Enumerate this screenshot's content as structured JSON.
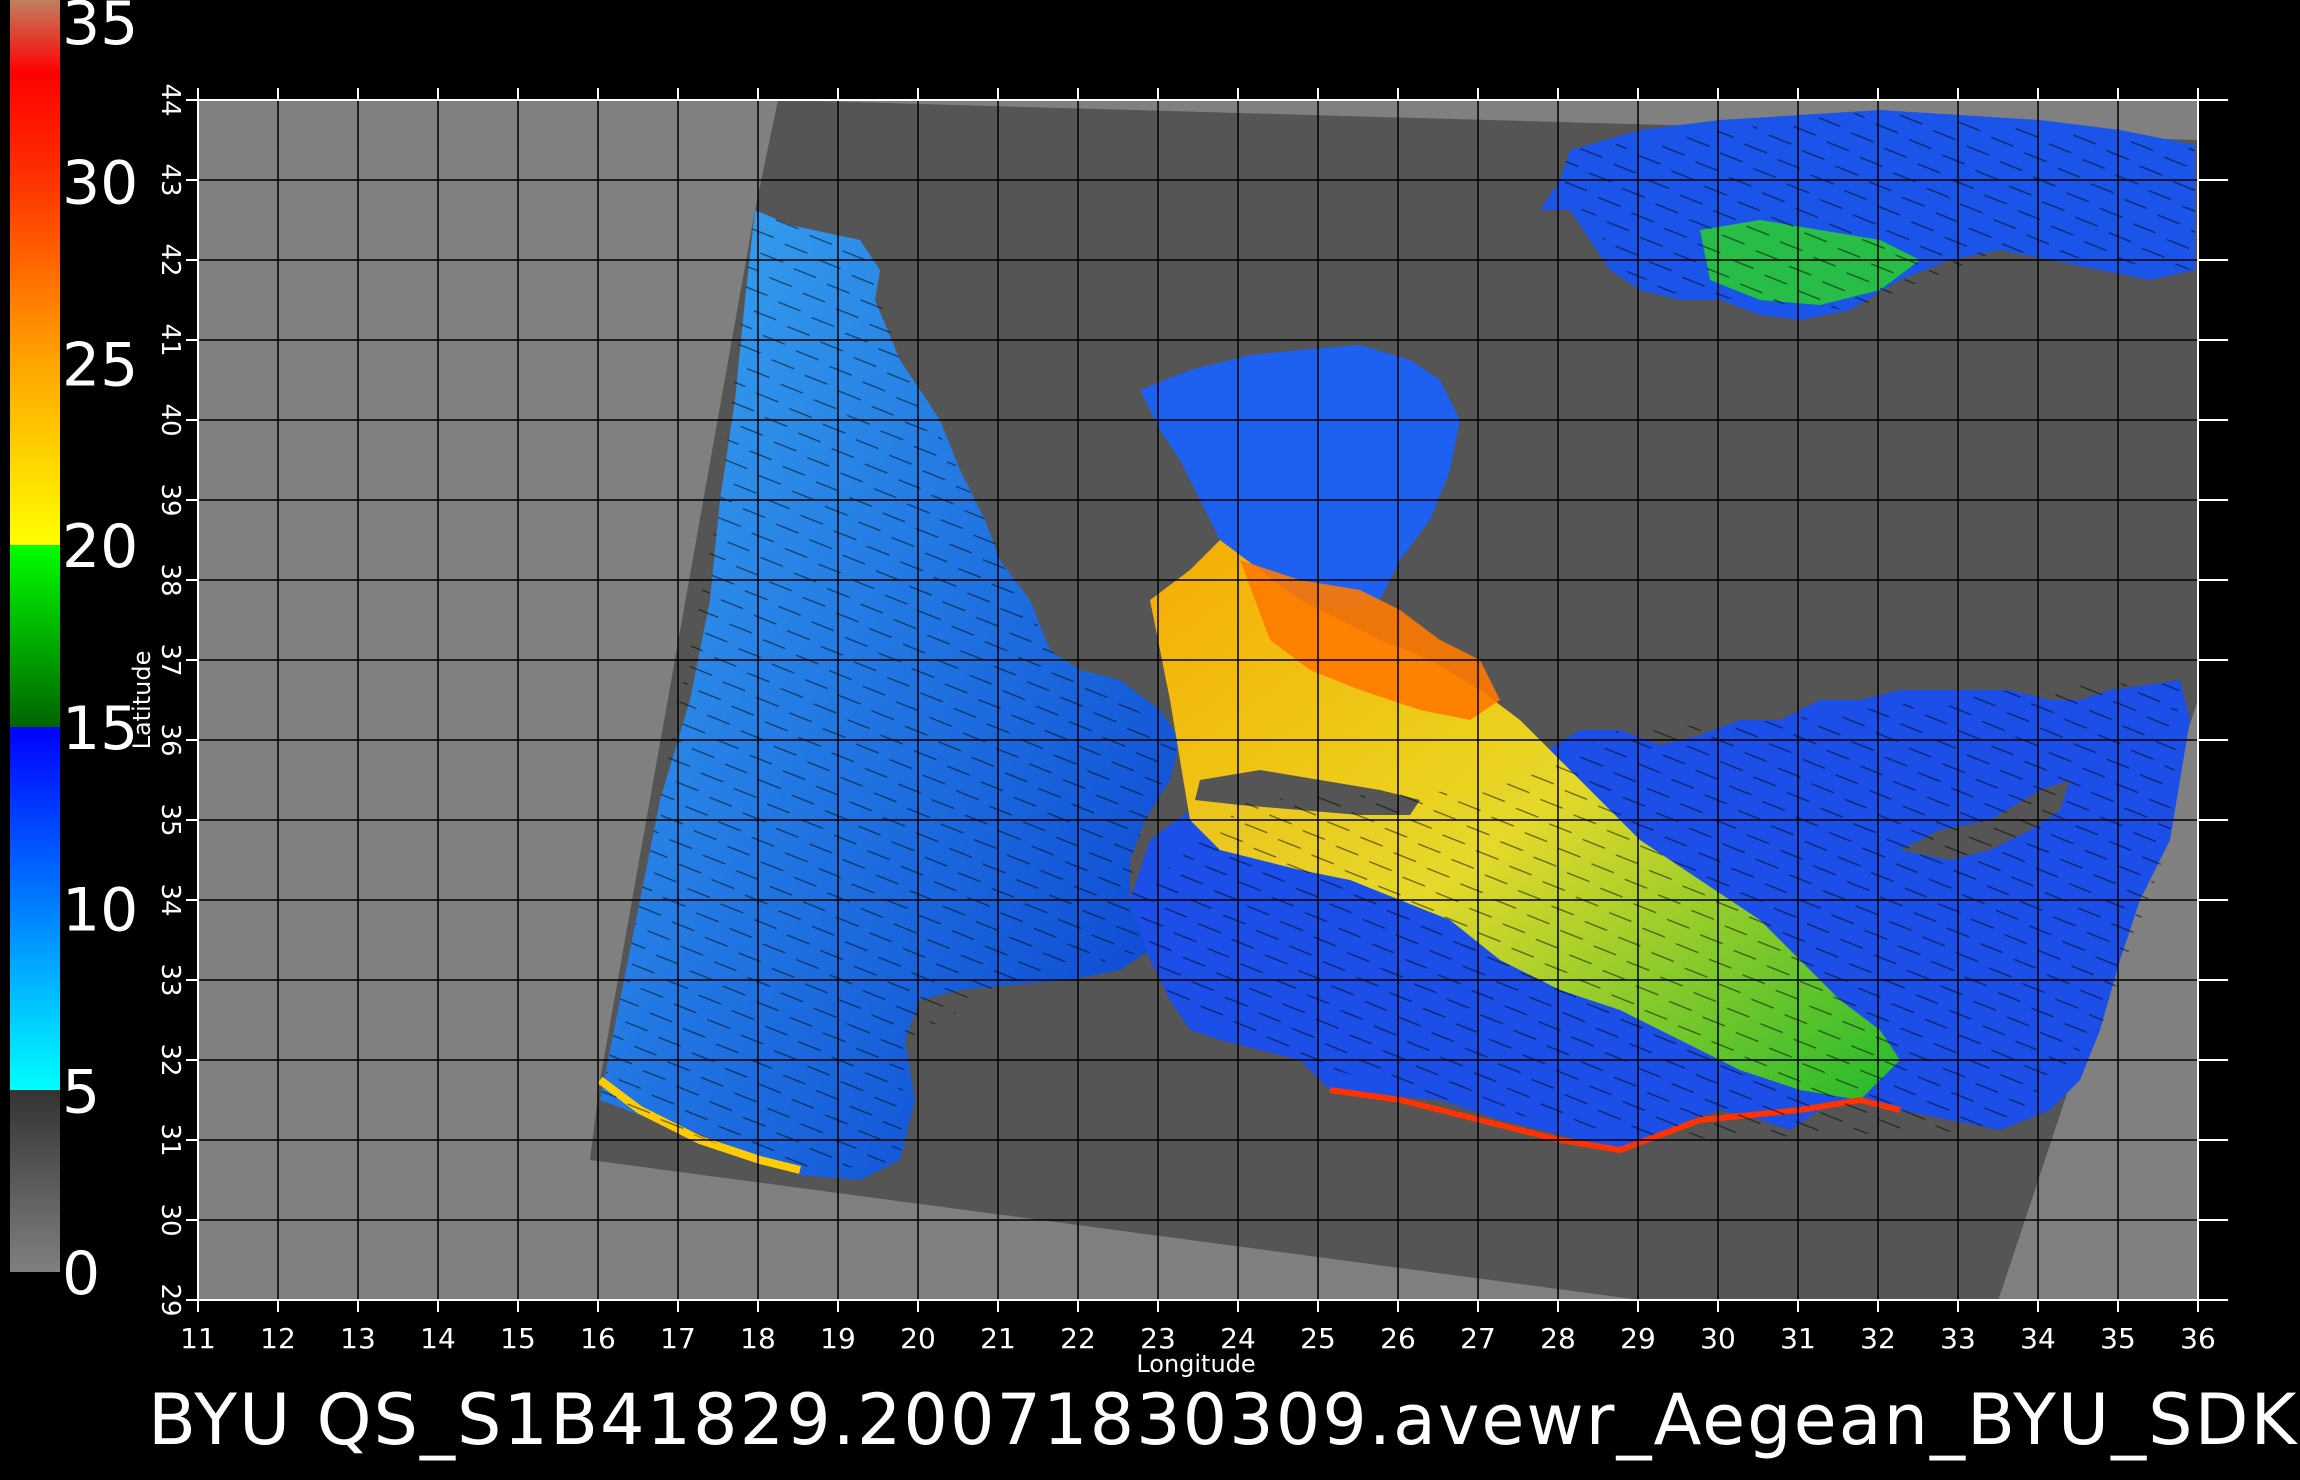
{
  "title": "BYU QS_S1B41829.20071830309.avewr_Aegean_BYU_SDK",
  "x_axis": {
    "label": "Longitude",
    "ticks": [
      "11",
      "12",
      "13",
      "14",
      "15",
      "16",
      "17",
      "18",
      "19",
      "20",
      "21",
      "22",
      "23",
      "24",
      "25",
      "26",
      "27",
      "28",
      "29",
      "30",
      "31",
      "32",
      "33",
      "34",
      "35",
      "36"
    ]
  },
  "y_axis": {
    "label": "Latitude",
    "ticks": [
      "29",
      "30",
      "31",
      "32",
      "33",
      "34",
      "35",
      "36",
      "37",
      "38",
      "39",
      "40",
      "41",
      "42",
      "43",
      "44"
    ]
  },
  "colorbar": {
    "range": [
      0,
      35
    ],
    "ticks": [
      "35",
      "30",
      "25",
      "20",
      "15",
      "10",
      "5",
      "0"
    ],
    "stops": [
      {
        "value": 0,
        "color": "#808080"
      },
      {
        "value": 5,
        "color": "#333333"
      },
      {
        "value": 5,
        "color": "#00ffff"
      },
      {
        "value": 15,
        "color": "#0000ff"
      },
      {
        "value": 15,
        "color": "#006400"
      },
      {
        "value": 20,
        "color": "#00ff00"
      },
      {
        "value": 20,
        "color": "#ffff00"
      },
      {
        "value": 25,
        "color": "#ffa500"
      },
      {
        "value": 30,
        "color": "#ff3300"
      },
      {
        "value": 33,
        "color": "#ff0000"
      },
      {
        "value": 35,
        "color": "#c08060"
      }
    ]
  },
  "colors": {
    "background": "#000000",
    "outside_swath": "#808080",
    "land": "#555555",
    "grid": "#000000",
    "text": "#ffffff"
  }
}
